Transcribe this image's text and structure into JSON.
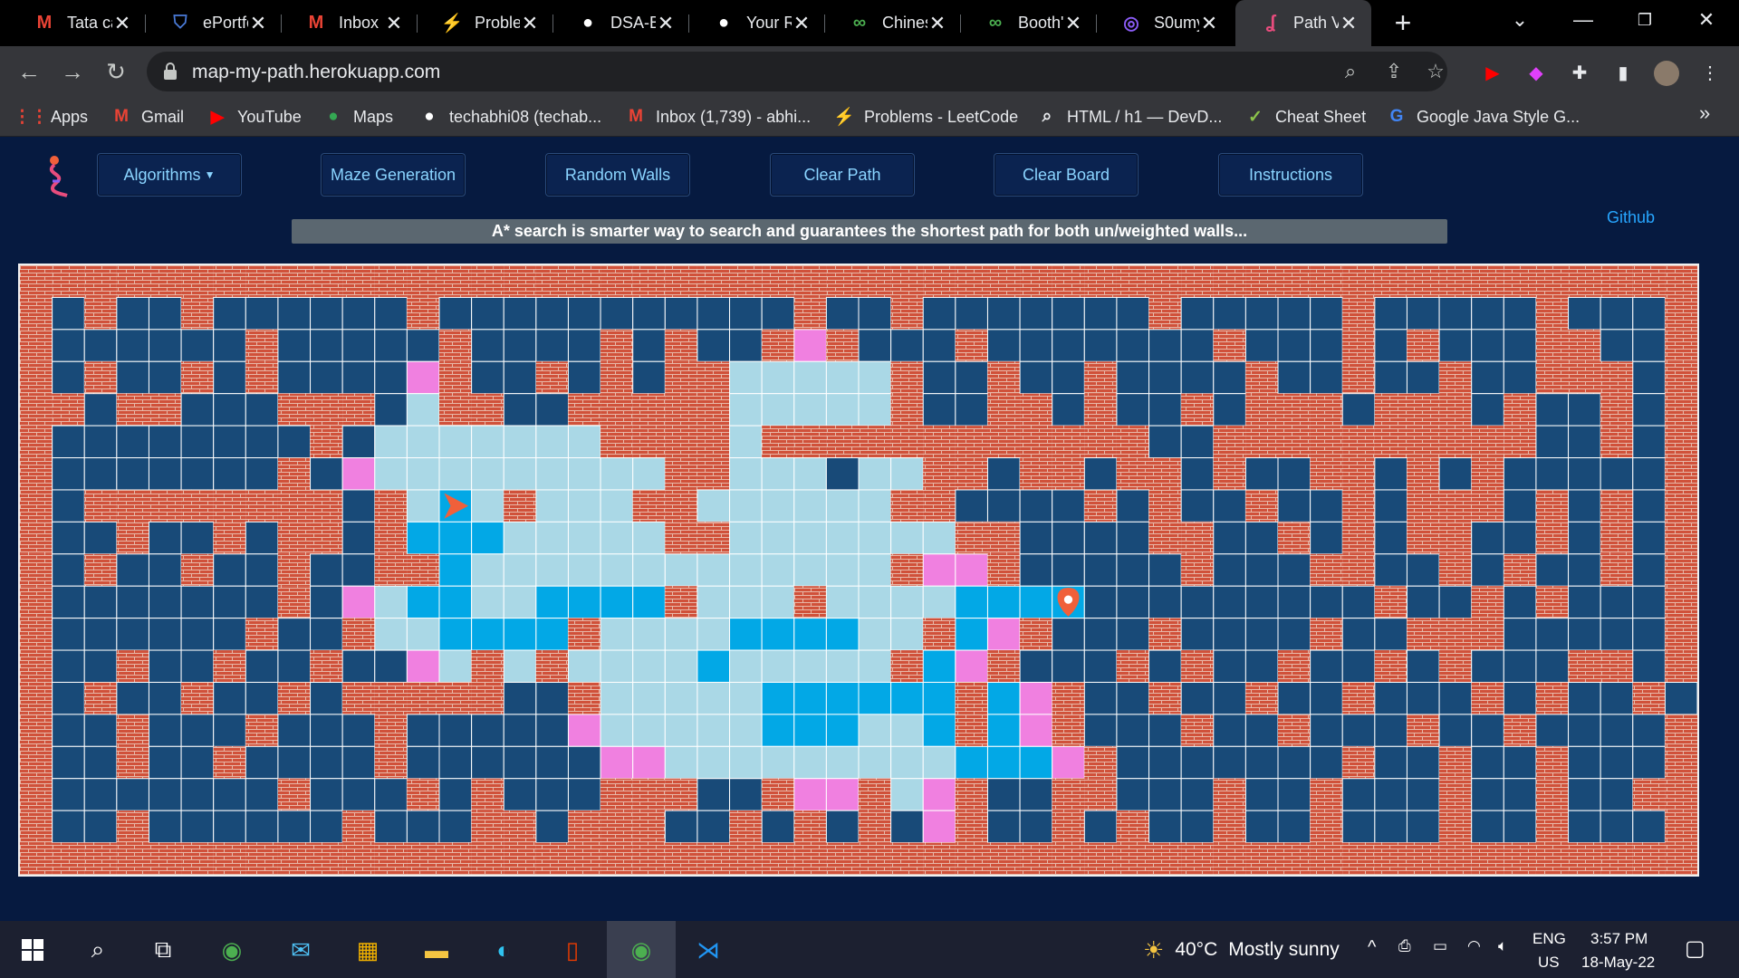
{
  "browser": {
    "tabs": [
      {
        "title": "Tata ca",
        "icon": "gmail-icon",
        "glyph": "M",
        "color": "#ea4335",
        "active": false
      },
      {
        "title": "ePortfc",
        "icon": "shield-crest-icon",
        "glyph": "⛉",
        "color": "#4a7bd8",
        "active": false
      },
      {
        "title": "Inbox (",
        "icon": "gmail-icon",
        "glyph": "M",
        "color": "#ea4335",
        "active": false
      },
      {
        "title": "Proble",
        "icon": "leetcode-icon",
        "glyph": "⚡",
        "color": "#ffa116",
        "active": false
      },
      {
        "title": "DSA-Bi",
        "icon": "github-icon",
        "glyph": "●",
        "color": "#ffffff",
        "active": false
      },
      {
        "title": "Your Re",
        "icon": "github-icon",
        "glyph": "●",
        "color": "#ffffff",
        "active": false
      },
      {
        "title": "Chines",
        "icon": "link-chain-icon",
        "glyph": "∞",
        "color": "#4caf50",
        "active": false
      },
      {
        "title": "Booth's",
        "icon": "link-chain-icon",
        "glyph": "∞",
        "color": "#4caf50",
        "active": false
      },
      {
        "title": "S0umy",
        "icon": "avatar-icon",
        "glyph": "◎",
        "color": "#8b5cf6",
        "active": false
      },
      {
        "title": "Path Vi",
        "icon": "path-logo-icon",
        "glyph": "ʆ",
        "color": "#e84c7d",
        "active": true
      }
    ],
    "url": "map-my-path.herokuapp.com",
    "bookmarks": [
      {
        "label": "Apps",
        "icon": "apps-grid-icon",
        "glyph": "⋮⋮",
        "color": "#ea4335"
      },
      {
        "label": "Gmail",
        "icon": "gmail-icon",
        "glyph": "M",
        "color": "#ea4335"
      },
      {
        "label": "YouTube",
        "icon": "youtube-icon",
        "glyph": "▶",
        "color": "#ff0000"
      },
      {
        "label": "Maps",
        "icon": "maps-pin-icon",
        "glyph": "●",
        "color": "#34a853"
      },
      {
        "label": "techabhi08 (techab...",
        "icon": "github-icon",
        "glyph": "●",
        "color": "#ffffff"
      },
      {
        "label": "Inbox (1,739) - abhi...",
        "icon": "gmail-icon",
        "glyph": "M",
        "color": "#ea4335"
      },
      {
        "label": "Problems - LeetCode",
        "icon": "leetcode-icon",
        "glyph": "⚡",
        "color": "#ffa116"
      },
      {
        "label": "HTML / h1 — DevD...",
        "icon": "search-doc-icon",
        "glyph": "⌕",
        "color": "#e8eaed"
      },
      {
        "label": "Cheat Sheet",
        "icon": "cheatsheet-icon",
        "glyph": "✓",
        "color": "#8bc34a"
      },
      {
        "label": "Google Java Style G...",
        "icon": "google-icon",
        "glyph": "G",
        "color": "#4285f4"
      }
    ]
  },
  "app": {
    "nav": [
      {
        "label": "Algorithms",
        "dropdown": true
      },
      {
        "label": "Maze Generation",
        "dropdown": false
      },
      {
        "label": "Random Walls",
        "dropdown": false
      },
      {
        "label": "Clear Path",
        "dropdown": false
      },
      {
        "label": "Clear Board",
        "dropdown": false
      },
      {
        "label": "Instructions",
        "dropdown": false
      }
    ],
    "github_label": "Github",
    "banner": "A* search is smarter way to search and guarantees the shortest path for both un/weighted walls...",
    "grid": {
      "rows": 19,
      "cols": 52,
      "colors": {
        "wall": "#d0513a",
        "mortar": "#e8b8a8",
        "empty": "#184a78",
        "visited": "#aad8e6",
        "path": "#02a8e6",
        "frontier": "#f080e0",
        "grid_line": "#ffffff",
        "start": "#f0603a",
        "end": "#f0603a"
      },
      "legend": "W=wall, .=empty, v=visited, p=path, f=frontier, S=start, E=end",
      "cells": [
        "WWWWWWWWWWWWWWWWWWWWWWWWWWWWWWWWWWWWWWWWWWWWWWWWWWWW",
        "W.W..W......W...........W..W.......W.....W.....W...W",
        "W......W.....W....W.W..WfW...W.......W...W.W...WW..W",
        "W.W..W.W....fW..W.W.WWvvvvvW..W..W....W..W..W..WWW.W",
        "WW.WW...WWW.vWW..WWWWWvvvvvW..WW.W..W.WWW.WWW.W..W.W",
        "W........W.vvvvvvvWWWWvWWWWWWWWWWWW..WWWWWWWWWW..W.W",
        "W.......W.fvvvvvvvvvWWvvv.vvWW.WW.WW.W..WW.W.W.....W",
        "W.WWWWWWWW.WvSvWvvvWWvvvvvvWW....W.W..W..W.WWW.W.W.W",
        "W..W..W.WW.WpppvvvvvWWvvvvvvvWW....WW..W.W.WW..W.W.W",
        "W.W..W..W..WWpvvvvvvvvvvvvvWffW.....W...WW..W.W..W.W",
        "W.......W.fvppvvppppWvvvWvvvvpppE.........W..W.W...W",
        "W......W..WvvppppWvvvvppppvvWpfW...W....W..WWW.....W",
        "W..W..W..W..fvWvWvvvvpvvvvvWpfW...W.W..W..W.W...WW.W",
        "W.W..W..W.WWWWW..WvvvvvppppppWpfW..W..W..W...W.W..W.W",
        "W..W...W...W.....fvvvvvpppvvpWpfW...W..W...W..W....W",
        "W..W..W....W......ffvvvvvvvvvpppfW.......W..W..W...W",
        "W.......W...W.W...WWW..WffWvfW..WW...W..W...W..W..W",
        "W..W......W...WW.WWW..W.W.W.fW..W.W..W..W...W..W...W",
        "WWWWWWWWWWWWWWWWWWWWWWWWWWWWWWWWWWWWWWWWWWWWWWWWWWWW"
      ]
    }
  },
  "taskbar": {
    "weather_temp": "40°C",
    "weather_desc": "Mostly sunny",
    "lang_top": "ENG",
    "lang_bottom": "US",
    "time": "3:57 PM",
    "date": "18-May-22"
  }
}
